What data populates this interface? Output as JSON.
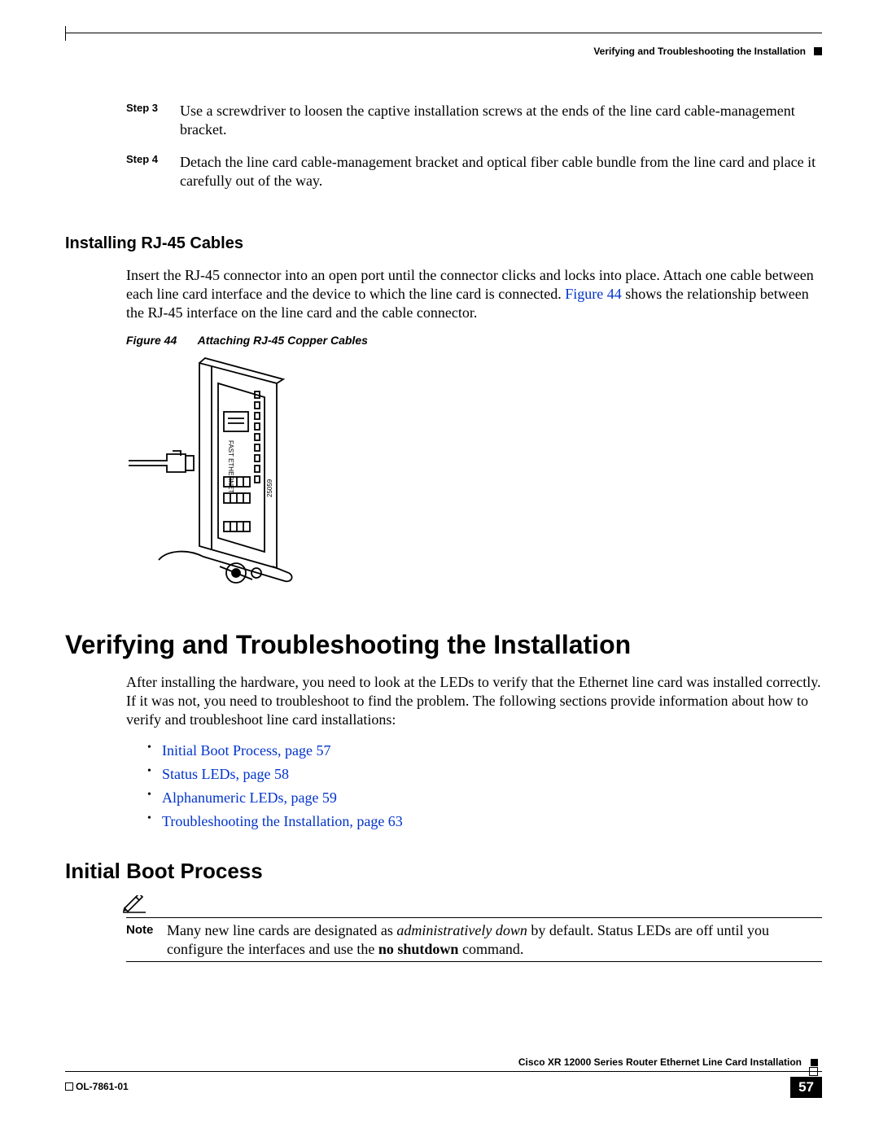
{
  "header": {
    "chapter": "Verifying and Troubleshooting the Installation"
  },
  "steps": [
    {
      "num": "Step 3",
      "text": "Use a screwdriver to loosen the captive installation screws at the ends of the line card cable-management bracket."
    },
    {
      "num": "Step 4",
      "text": "Detach the line card cable-management bracket and optical fiber cable bundle from the line card and place it carefully out of the way."
    }
  ],
  "rj45": {
    "heading": "Installing RJ-45 Cables",
    "para_before_link": "Insert the RJ-45 connector into an open port until the connector clicks and locks into place. Attach one cable between each line card interface and the device to which the line card is connected. ",
    "link": "Figure 44",
    "para_after_link": " shows the relationship between the RJ-45 interface on the line card and the cable connector.",
    "fig_num": "Figure 44",
    "fig_title": "Attaching RJ-45 Copper Cables",
    "fig_label_vertical": "FAST ETHERNET",
    "fig_id": "25059"
  },
  "verify": {
    "heading": "Verifying and Troubleshooting the Installation",
    "para": "After installing the hardware, you need to look at the LEDs to verify that the Ethernet line card was installed correctly. If it was not, you need to troubleshoot to find the problem. The following sections provide information about how to verify and troubleshoot line card installations:",
    "links": [
      "Initial Boot Process, page 57",
      "Status LEDs, page 58",
      "Alphanumeric LEDs, page 59",
      "Troubleshooting the Installation, page 63"
    ]
  },
  "boot": {
    "heading": "Initial Boot Process",
    "note_label": "Note",
    "note_before_em": "Many new line cards are designated as ",
    "note_em": "administratively down",
    "note_mid": " by default. Status LEDs are off until you configure the interfaces and use the ",
    "note_bold": "no shutdown",
    "note_after": " command."
  },
  "footer": {
    "title": "Cisco XR 12000 Series Router Ethernet Line Card Installation",
    "doc": "OL-7861-01",
    "page": "57"
  }
}
